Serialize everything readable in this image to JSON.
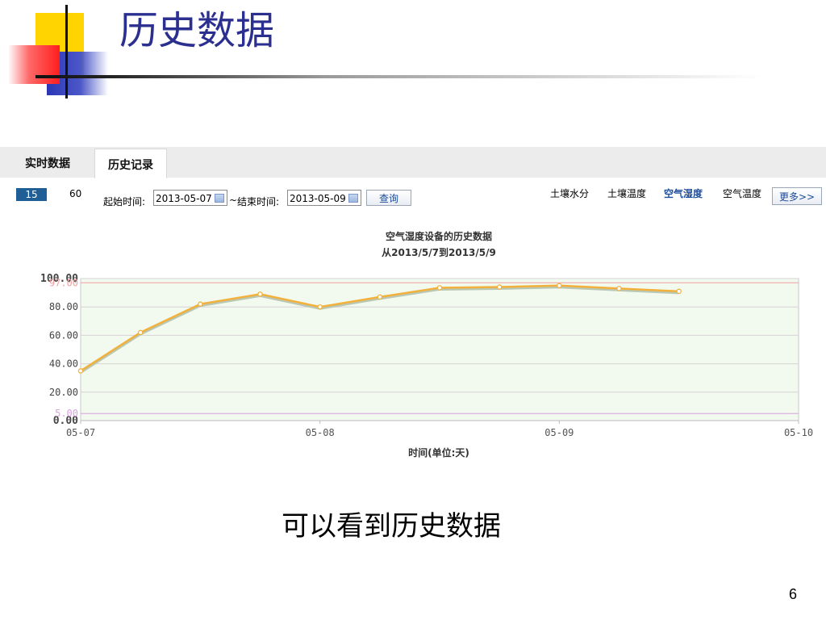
{
  "slide": {
    "title": "历史数据",
    "caption": "可以看到历史数据",
    "page_number": "6"
  },
  "tabs": {
    "realtime": "实时数据",
    "history": "历史记录"
  },
  "toolbar": {
    "range_15": "15",
    "range_60": "60",
    "start_label": "起始时间:",
    "start_value": "2013-05-07",
    "separator": "~",
    "end_label": "结束时间:",
    "end_value": "2013-05-09",
    "query": "查询"
  },
  "metrics": {
    "soil_moisture": "土壤水分",
    "soil_temp": "土壤温度",
    "air_humidity": "空气湿度",
    "air_temp": "空气温度",
    "more": "更多>>"
  },
  "colors": {
    "line": "#f2b13c",
    "plot_bg": "#f2f9ee",
    "upper_threshold": "#f0a0a0",
    "lower_threshold": "#d9a0e0",
    "accent": "#1f5f95"
  },
  "chart_data": {
    "type": "line",
    "title": "空气湿度设备的历史数据",
    "subtitle": "从2013/5/7到2013/5/9",
    "xlabel": "时间(单位:天)",
    "ylabel": "",
    "x_ticks": [
      "05-07",
      "05-08",
      "05-09",
      "05-10"
    ],
    "x_range": [
      0,
      3
    ],
    "ylim": [
      0,
      100
    ],
    "y_ticks": [
      "0.00",
      "20.00",
      "40.00",
      "60.00",
      "80.00",
      "100.00"
    ],
    "thresholds": [
      {
        "label": "97.00",
        "value": 97
      },
      {
        "label": "5.00",
        "value": 5
      }
    ],
    "x": [
      0,
      0.25,
      0.5,
      0.75,
      1.0,
      1.25,
      1.5,
      1.75,
      2.0,
      2.25,
      2.5
    ],
    "values": [
      35,
      62,
      82,
      89,
      80,
      87,
      93.5,
      94,
      95,
      93,
      91
    ],
    "grid": true,
    "legend": "none"
  }
}
